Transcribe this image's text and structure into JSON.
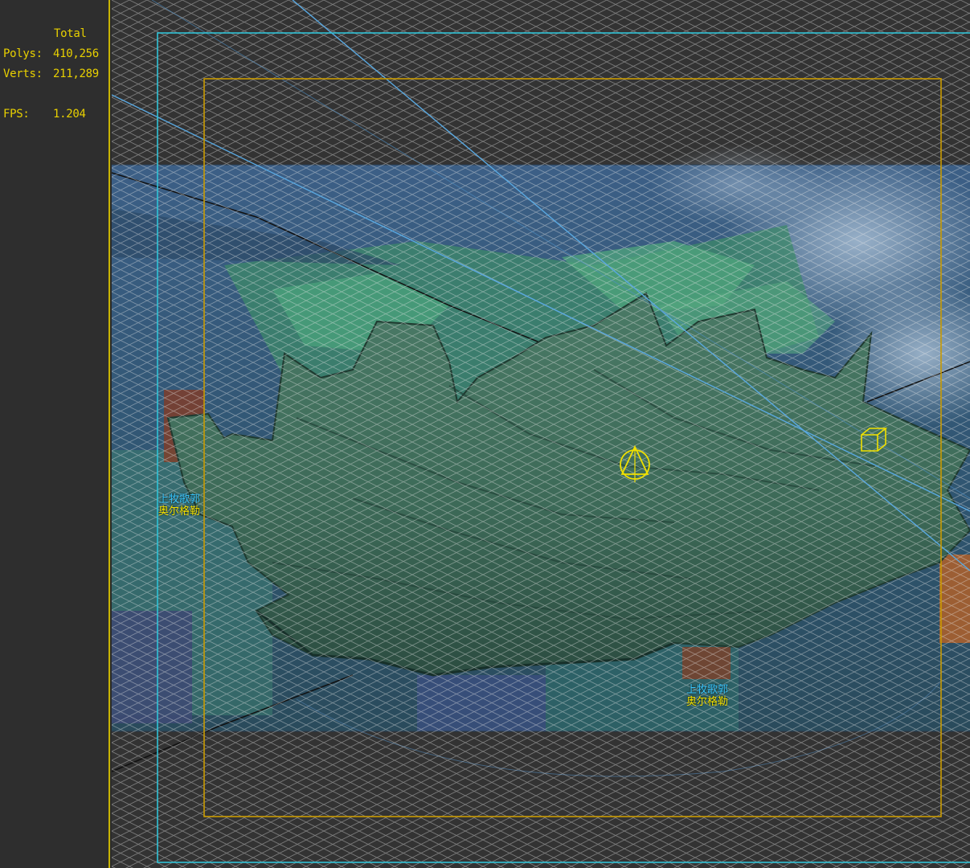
{
  "stats": {
    "header": "Total",
    "polys_label": "Polys:",
    "polys_value": "410,256",
    "verts_label": "Verts:",
    "verts_value": "211,289",
    "fps_label": "FPS:",
    "fps_value": "1.204"
  },
  "colors": {
    "stats_text": "#e8d000",
    "safe_frame_outer": "#2fc2d6",
    "safe_frame_inner": "#c99a00",
    "mesh_rock": "#3f6f5c",
    "gizmo": "#f0e000"
  },
  "scene_labels": [
    {
      "line1": "上牧歌郭",
      "line2": "奥尔格勒"
    },
    {
      "line1": "上牧歌郭",
      "line2": "奥尔格勒"
    }
  ],
  "gizmos": [
    "light-gizmo-icon",
    "box-helper-icon"
  ]
}
